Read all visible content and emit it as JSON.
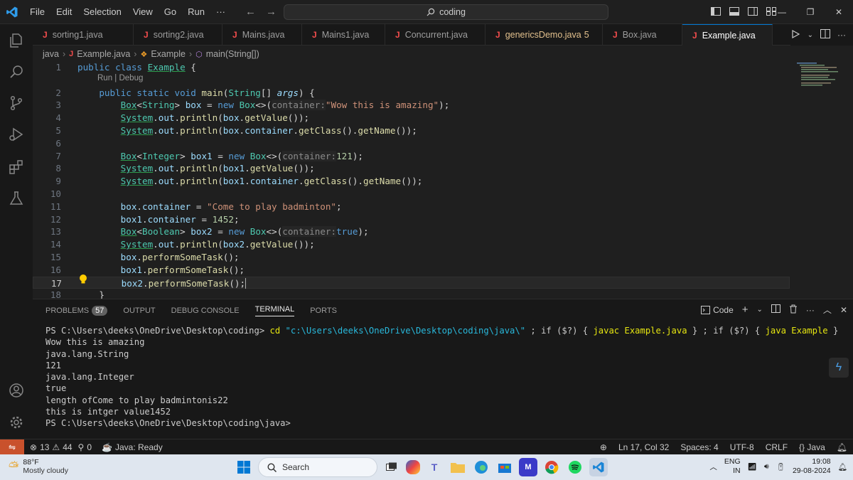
{
  "titlebar": {
    "menu": [
      "File",
      "Edit",
      "Selection",
      "View",
      "Go",
      "Run",
      "···"
    ],
    "search_text": "coding"
  },
  "tabs": [
    {
      "label": "sorting1.java",
      "state": "normal"
    },
    {
      "label": "sorting2.java",
      "state": "normal"
    },
    {
      "label": "Mains.java",
      "state": "normal"
    },
    {
      "label": "Mains1.java",
      "state": "normal"
    },
    {
      "label": "Concurrent.java",
      "state": "normal"
    },
    {
      "label": "genericsDemo.java",
      "count": "5",
      "state": "modified"
    },
    {
      "label": "Box.java",
      "state": "normal"
    },
    {
      "label": "Example.java",
      "state": "active"
    }
  ],
  "breadcrumb": {
    "folder": "java",
    "file": "Example.java",
    "class": "Example",
    "method": "main(String[])"
  },
  "editor": {
    "codelens": "Run | Debug",
    "line_numbers": [
      "1",
      "2",
      "3",
      "4",
      "5",
      "6",
      "7",
      "8",
      "9",
      "10",
      "11",
      "12",
      "13",
      "14",
      "15",
      "16",
      "17",
      "18"
    ]
  },
  "panel": {
    "tabs": [
      "PROBLEMS",
      "OUTPUT",
      "DEBUG CONSOLE",
      "TERMINAL",
      "PORTS"
    ],
    "problems_count": "57",
    "active_tab": "TERMINAL",
    "terminal_profile": "Code",
    "terminal": {
      "prompt1": "PS C:\\Users\\deeks\\OneDrive\\Desktop\\coding> ",
      "cmd_cd": "cd ",
      "cmd_path": "\"c:\\Users\\deeks\\OneDrive\\Desktop\\coding\\java\\\"",
      "cmd_rest1": " ; if ($?) { ",
      "cmd_javac": "javac Example.java",
      "cmd_rest2": " } ; if ($?) { ",
      "cmd_java": "java Example",
      "cmd_rest3": " }",
      "output": [
        "Wow this is amazing",
        "java.lang.String",
        "121",
        "java.lang.Integer",
        "true",
        "length ofCome to play badmintonis22",
        "this is intger value1452"
      ],
      "prompt2": "PS C:\\Users\\deeks\\OneDrive\\Desktop\\coding\\java>"
    }
  },
  "statusbar": {
    "errors": "13",
    "warnings": "44",
    "ports": "0",
    "java_status": "Java: Ready",
    "position": "Ln 17, Col 32",
    "spaces": "Spaces: 4",
    "encoding": "UTF-8",
    "eol": "CRLF",
    "language": "Java"
  },
  "taskbar": {
    "temperature": "88°F",
    "weather": "Mostly cloudy",
    "search_placeholder": "Search",
    "lang1": "ENG",
    "lang2": "IN",
    "time": "19:08",
    "date": "29-08-2024"
  },
  "colors": {
    "accent": "#0078d4",
    "error": "#f14c4c",
    "remote": "#c9512c"
  }
}
